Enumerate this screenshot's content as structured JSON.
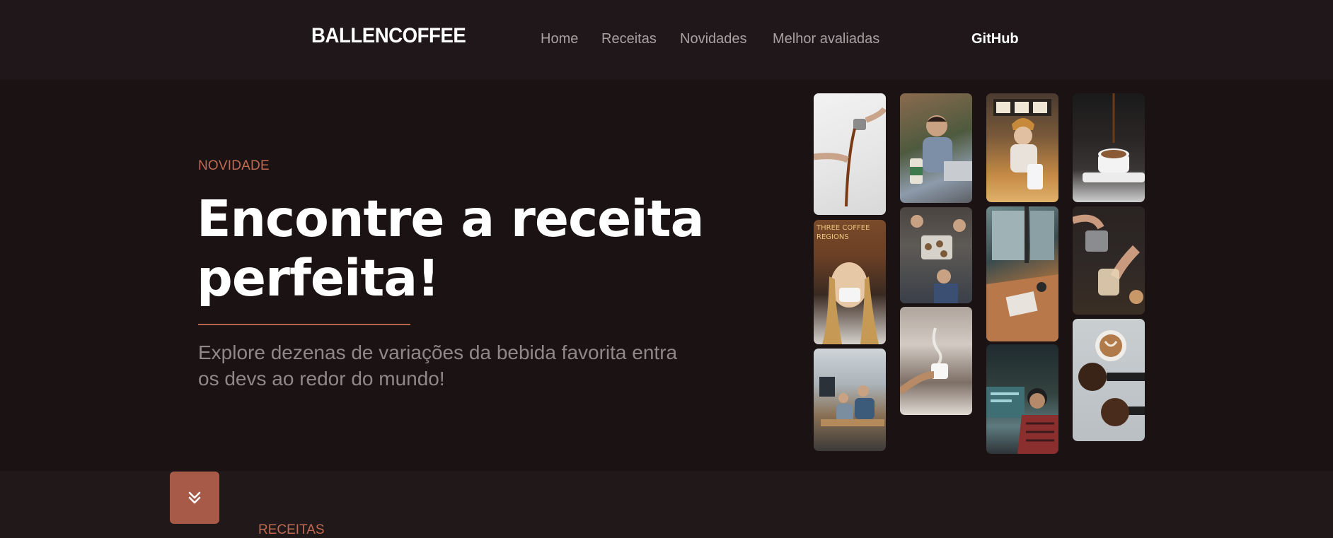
{
  "header": {
    "logo": "BALLENCOFFEE",
    "nav": [
      "Home",
      "Receitas",
      "Novidades",
      "Melhor avaliadas"
    ],
    "github": "GitHub"
  },
  "hero": {
    "eyebrow": "NOVIDADE",
    "title_line1": "Encontre a receita",
    "title_line2": "perfeita!",
    "subtitle_line1": "Explore dezenas de variações da bebida favorita entra",
    "subtitle_line2": "os devs ao redor do mundo!"
  },
  "gallery": {
    "photos": [
      "coffee-pour-photo",
      "woman-drinking-coffee-photo",
      "office-team-photo",
      "man-laptop-coffee-photo",
      "baristas-photo",
      "coffee-steam-photo",
      "woman-cafe-counter-photo",
      "window-desk-photo",
      "developer-monitor-photo",
      "coffee-cup-pour-photo",
      "latte-art-pour-photo",
      "espresso-beans-photo"
    ]
  },
  "next_section": {
    "label": "RECEITAS",
    "scroll_icon": "chevrons-down-icon"
  },
  "colors": {
    "accent": "#c06a52",
    "button": "#a85a48",
    "background": "#1b1214"
  }
}
